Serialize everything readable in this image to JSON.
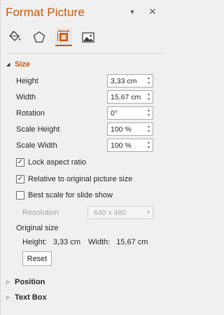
{
  "pane": {
    "title": "Format Picture",
    "pin_icon": "chevron-down-icon",
    "close_icon": "close-icon",
    "accent_color": "#c55a11"
  },
  "tabs": [
    {
      "icon": "fill-line-icon",
      "active": false
    },
    {
      "icon": "effects-pentagon-icon",
      "active": false
    },
    {
      "icon": "size-properties-icon",
      "active": true
    },
    {
      "icon": "picture-icon",
      "active": false
    }
  ],
  "size_section": {
    "title": "Size",
    "height_label": "Height",
    "height_value": "3,33 cm",
    "width_label": "Width",
    "width_value": "15,67 cm",
    "rotation_label": "Rotation",
    "rotation_value": "0°",
    "scale_height_label": "Scale Height",
    "scale_height_value": "100 %",
    "scale_width_label": "Scale Width",
    "scale_width_value": "100 %",
    "lock_aspect_label": "Lock aspect ratio",
    "lock_aspect_checked": true,
    "relative_label": "Relative to original picture size",
    "relative_checked": true,
    "best_scale_label": "Best scale for slide show",
    "best_scale_checked": false,
    "resolution_label": "Resolution",
    "resolution_value": "640 x 480",
    "original_size_label": "Original size",
    "orig_height_label": "Height:",
    "orig_height_value": "3,33 cm",
    "orig_width_label": "Width:",
    "orig_width_value": "15,67 cm",
    "reset_label": "Reset"
  },
  "sections": {
    "position": "Position",
    "text_box": "Text Box"
  }
}
